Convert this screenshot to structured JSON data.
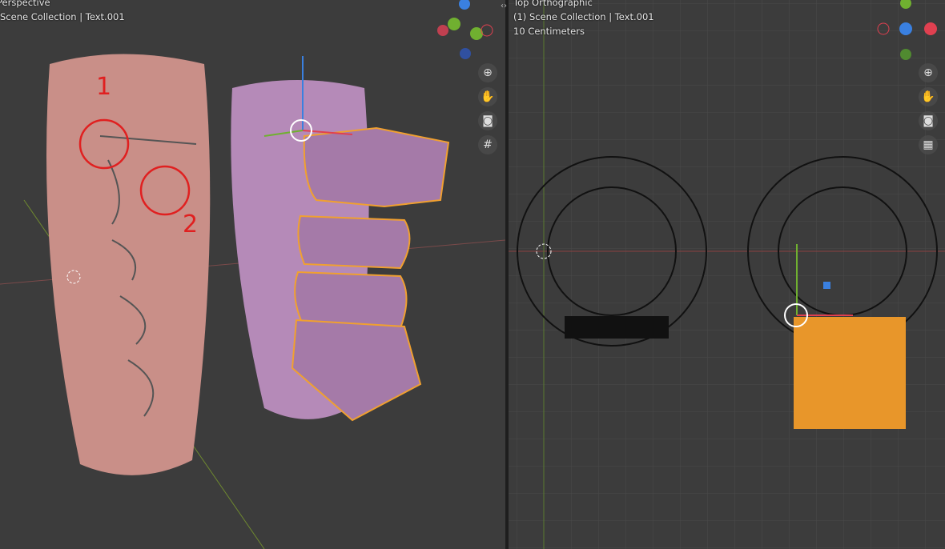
{
  "left_viewport": {
    "mode": "Perspective",
    "collection": "Scene Collection | Text.001",
    "annotations": [
      "1",
      "2"
    ],
    "nav_icons": [
      "zoom-icon",
      "hand-pan-icon",
      "camera-icon",
      "grid-perspective-icon"
    ],
    "gizmo_axes": [
      "Z",
      "Y",
      "X"
    ]
  },
  "right_viewport": {
    "mode": "Top Orthographic",
    "collection": "(1) Scene Collection | Text.001",
    "scale": "10 Centimeters",
    "nav_icons": [
      "zoom-icon",
      "hand-pan-icon",
      "camera-icon",
      "grid-ortho-icon"
    ],
    "gizmo_axes": [
      "Y",
      "Z",
      "X"
    ]
  },
  "colors": {
    "selection": "#f0a030",
    "annotation": "#e02020",
    "x_axis": "#e04050",
    "y_axis": "#70b030",
    "z_axis": "#3a80e0"
  }
}
